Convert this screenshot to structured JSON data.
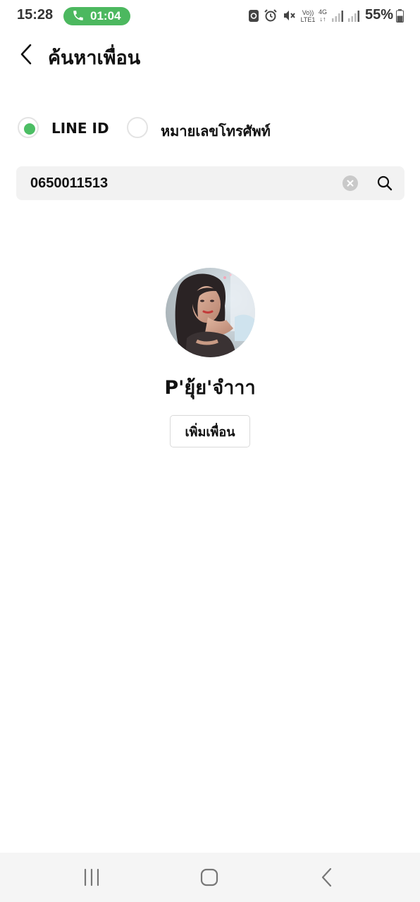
{
  "status_bar": {
    "time": "15:28",
    "call_duration": "01:04",
    "volte_label": "Vo)) LTE1",
    "network_label": "4G",
    "battery_percent": "55%",
    "battery_level": 0.55,
    "icons": [
      "phone-icon",
      "sync-icon",
      "alarm-icon",
      "mute-icon",
      "signal-icon",
      "battery-icon"
    ]
  },
  "header": {
    "title": "ค้นหาเพื่อน",
    "back_icon": "chevron-left-icon"
  },
  "search_type": {
    "options": [
      {
        "label": "LINE ID",
        "selected": true
      },
      {
        "label": "หมายเลขโทรศัพท์",
        "selected": false
      }
    ]
  },
  "search": {
    "value": "0650011513",
    "clear_icon": "clear-icon",
    "search_icon": "search-icon"
  },
  "result": {
    "name": "P'ยุ้ย'จำาา",
    "add_button_label": "เพิ่มเพื่อน"
  },
  "navbar": {
    "icons": [
      "recent-apps-icon",
      "home-icon",
      "back-icon"
    ]
  },
  "colors": {
    "accent": "#4cbe64",
    "call_pill": "#4cb85f",
    "search_bg": "#f2f2f2",
    "navbar_bg": "#f5f5f5"
  }
}
